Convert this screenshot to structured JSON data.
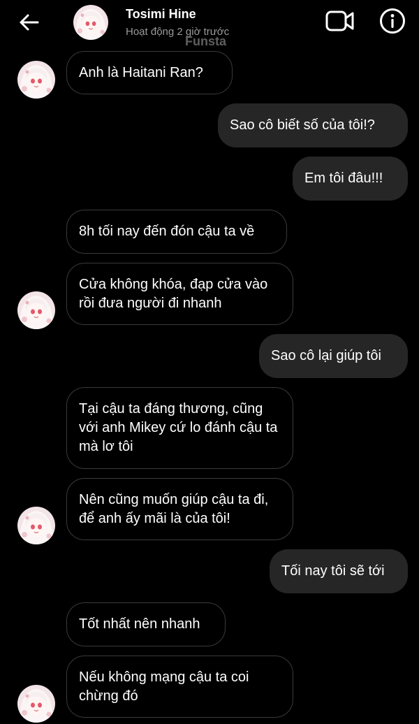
{
  "header": {
    "contact_name": "Tosimi Hine",
    "status": "Hoạt động 2 giờ trước",
    "watermark": "Funsta",
    "icons": [
      "back-arrow-icon",
      "video-call-icon",
      "info-icon"
    ]
  },
  "messages": [
    {
      "direction": "incoming",
      "text": "Anh là Haitani Ran?"
    },
    {
      "direction": "outgoing",
      "text": "Sao cô biết số của tôi!?"
    },
    {
      "direction": "outgoing",
      "text": "Em tôi đâu!!!"
    },
    {
      "direction": "incoming",
      "text": "8h tối nay đến đón cậu ta về"
    },
    {
      "direction": "incoming",
      "text": "Cửa không khóa, đạp cửa vào rồi đưa người đi nhanh"
    },
    {
      "direction": "outgoing",
      "text": "Sao cô lại giúp tôi"
    },
    {
      "direction": "incoming",
      "text": "Tại cậu ta đáng thương, cũng với anh Mikey cứ lo đánh cậu ta mà lơ tôi"
    },
    {
      "direction": "incoming",
      "text": "Nên cũng muốn giúp cậu ta đi, để anh ấy mãi là của tôi!"
    },
    {
      "direction": "outgoing",
      "text": "Tối nay tôi sẽ tới"
    },
    {
      "direction": "incoming",
      "text": "Tốt nhất nên nhanh"
    },
    {
      "direction": "incoming",
      "text": "Nếu không mạng cậu ta coi chừng đó"
    }
  ],
  "colors": {
    "background": "#000000",
    "outgoing_bubble": "#262626",
    "incoming_border": "#3a3a3a",
    "status_text": "#9a9a9a"
  }
}
